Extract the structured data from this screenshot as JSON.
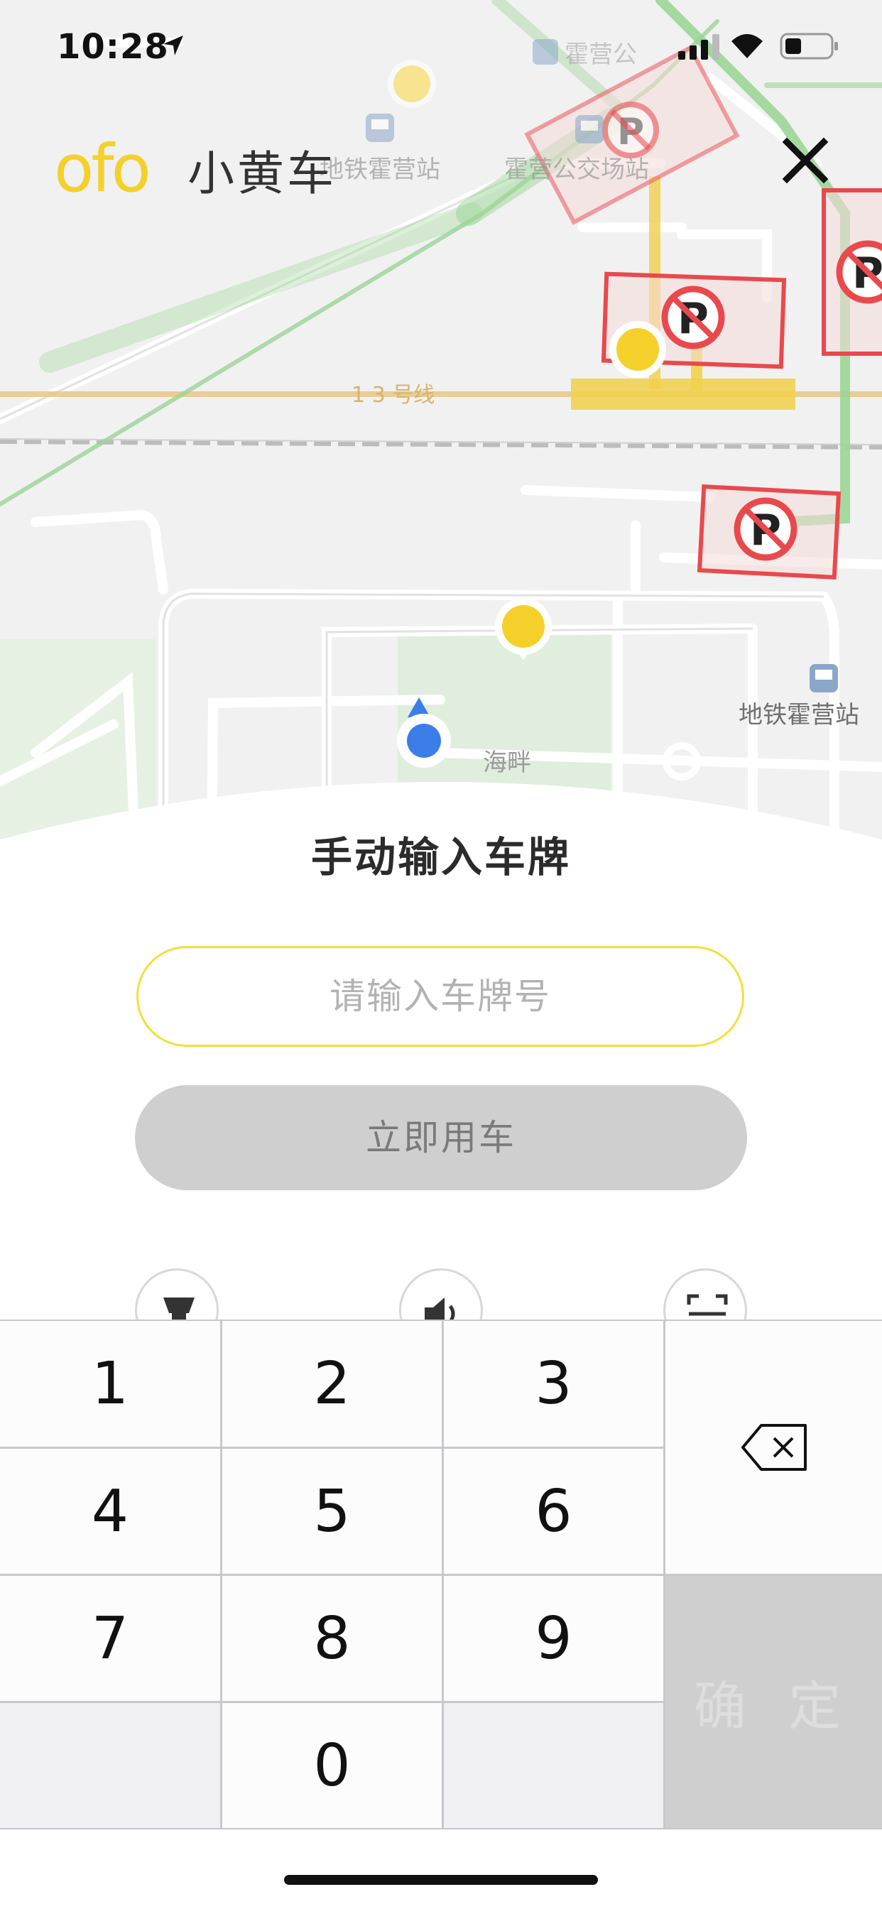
{
  "status_bar": {
    "time": "10:28"
  },
  "map": {
    "labels": {
      "station_1": "地铁霍营站",
      "station_2": "霍营公交场站",
      "station_3": "地铁霍营站",
      "line_13": "1 3 号线",
      "top_label": "霍营公",
      "park_label": "海畔"
    }
  },
  "header": {
    "logo_text": "ofo",
    "logo_cn": "小黄车",
    "close_icon": "close-icon"
  },
  "panel": {
    "title": "手动输入车牌",
    "plate_input": {
      "placeholder": "请输入车牌号",
      "value": ""
    },
    "use_button_label": "立即用车",
    "tools": [
      {
        "name": "flashlight",
        "icon": "flashlight-icon"
      },
      {
        "name": "voice",
        "icon": "speaker-icon"
      },
      {
        "name": "scan",
        "icon": "scan-icon"
      }
    ]
  },
  "keypad": {
    "keys": [
      "1",
      "2",
      "3",
      "4",
      "5",
      "6",
      "7",
      "8",
      "9",
      "0"
    ],
    "confirm_label": "确 定",
    "backspace_icon": "backspace-icon"
  },
  "colors": {
    "brand_yellow": "#f5d02a",
    "no_parking_red": "#e9494d",
    "disabled_gray": "#cfcfcf"
  }
}
